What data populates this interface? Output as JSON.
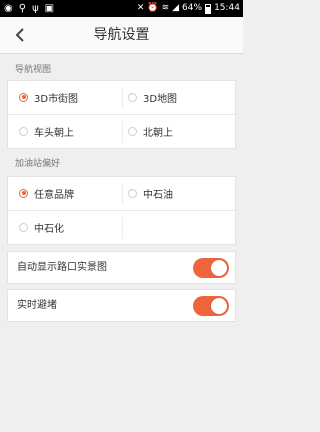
{
  "status_bar": {
    "left_icons": [
      "notification-icon",
      "location-icon",
      "wifi-hotspot-icon",
      "image-icon"
    ],
    "right_icons": [
      "mute-icon",
      "alarm-icon",
      "wifi-icon",
      "signal-icon",
      "battery-icon"
    ],
    "battery": "64%",
    "time": "15:44"
  },
  "header": {
    "back_icon": "chevron-left-icon",
    "title": "导航设置"
  },
  "nav_view": {
    "section_title": "导航视图",
    "options": [
      {
        "label": "3D市街图",
        "selected": true
      },
      {
        "label": "3D地图",
        "selected": false
      },
      {
        "label": "车头朝上",
        "selected": false
      },
      {
        "label": "北朝上",
        "selected": false
      }
    ]
  },
  "gas_pref": {
    "section_title": "加油站偏好",
    "options": [
      {
        "label": "任意品牌",
        "selected": true
      },
      {
        "label": "中石油",
        "selected": false
      },
      {
        "label": "中石化",
        "selected": false
      }
    ]
  },
  "toggles": [
    {
      "label": "自动显示路口实景图",
      "on": true
    },
    {
      "label": "实时避堵",
      "on": true
    }
  ],
  "colors": {
    "accent": "#f0643c",
    "background": "#efefef"
  }
}
